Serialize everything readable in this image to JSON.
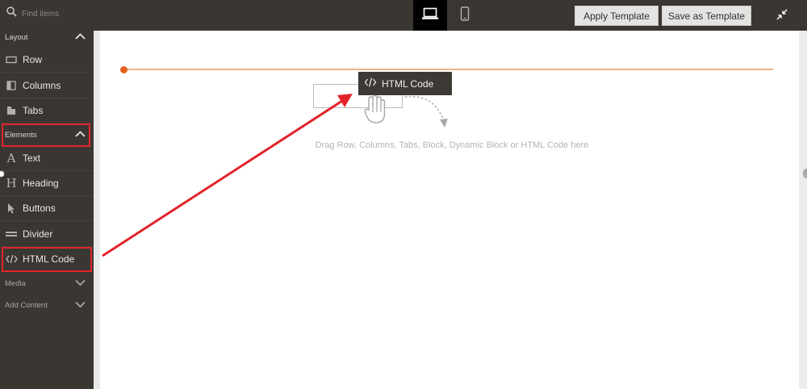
{
  "search": {
    "placeholder": "Find items"
  },
  "toolbar": {
    "apply_template_label": "Apply Template",
    "save_as_template_label": "Save as Template",
    "device_desktop_icon": "laptop-icon",
    "device_mobile_icon": "mobile-icon",
    "collapse_icon": "minimize-icon"
  },
  "sidebar": {
    "sections": [
      {
        "label": "Layout",
        "state": "expanded"
      },
      {
        "label": "Elements",
        "state": "expanded"
      },
      {
        "label": "Media",
        "state": "collapsed"
      },
      {
        "label": "Add Content",
        "state": "collapsed"
      }
    ],
    "layout_items": [
      {
        "label": "Row",
        "icon": "row-icon"
      },
      {
        "label": "Columns",
        "icon": "columns-icon"
      },
      {
        "label": "Tabs",
        "icon": "tabs-icon"
      }
    ],
    "element_items": [
      {
        "label": "Text",
        "icon": "text-icon"
      },
      {
        "label": "Heading",
        "icon": "heading-icon"
      },
      {
        "label": "Buttons",
        "icon": "cursor-icon"
      },
      {
        "label": "Divider",
        "icon": "divider-icon"
      },
      {
        "label": "HTML Code",
        "icon": "code-icon"
      }
    ]
  },
  "stage": {
    "drag_chip_label": "HTML Code",
    "drop_hint": "Drag Row, Columns, Tabs, Block, Dynamic Block or HTML Code here"
  },
  "colors": {
    "sidebar_bg": "#3a3733",
    "highlight_red": "#e3232a",
    "row_accent": "#e8611d"
  }
}
